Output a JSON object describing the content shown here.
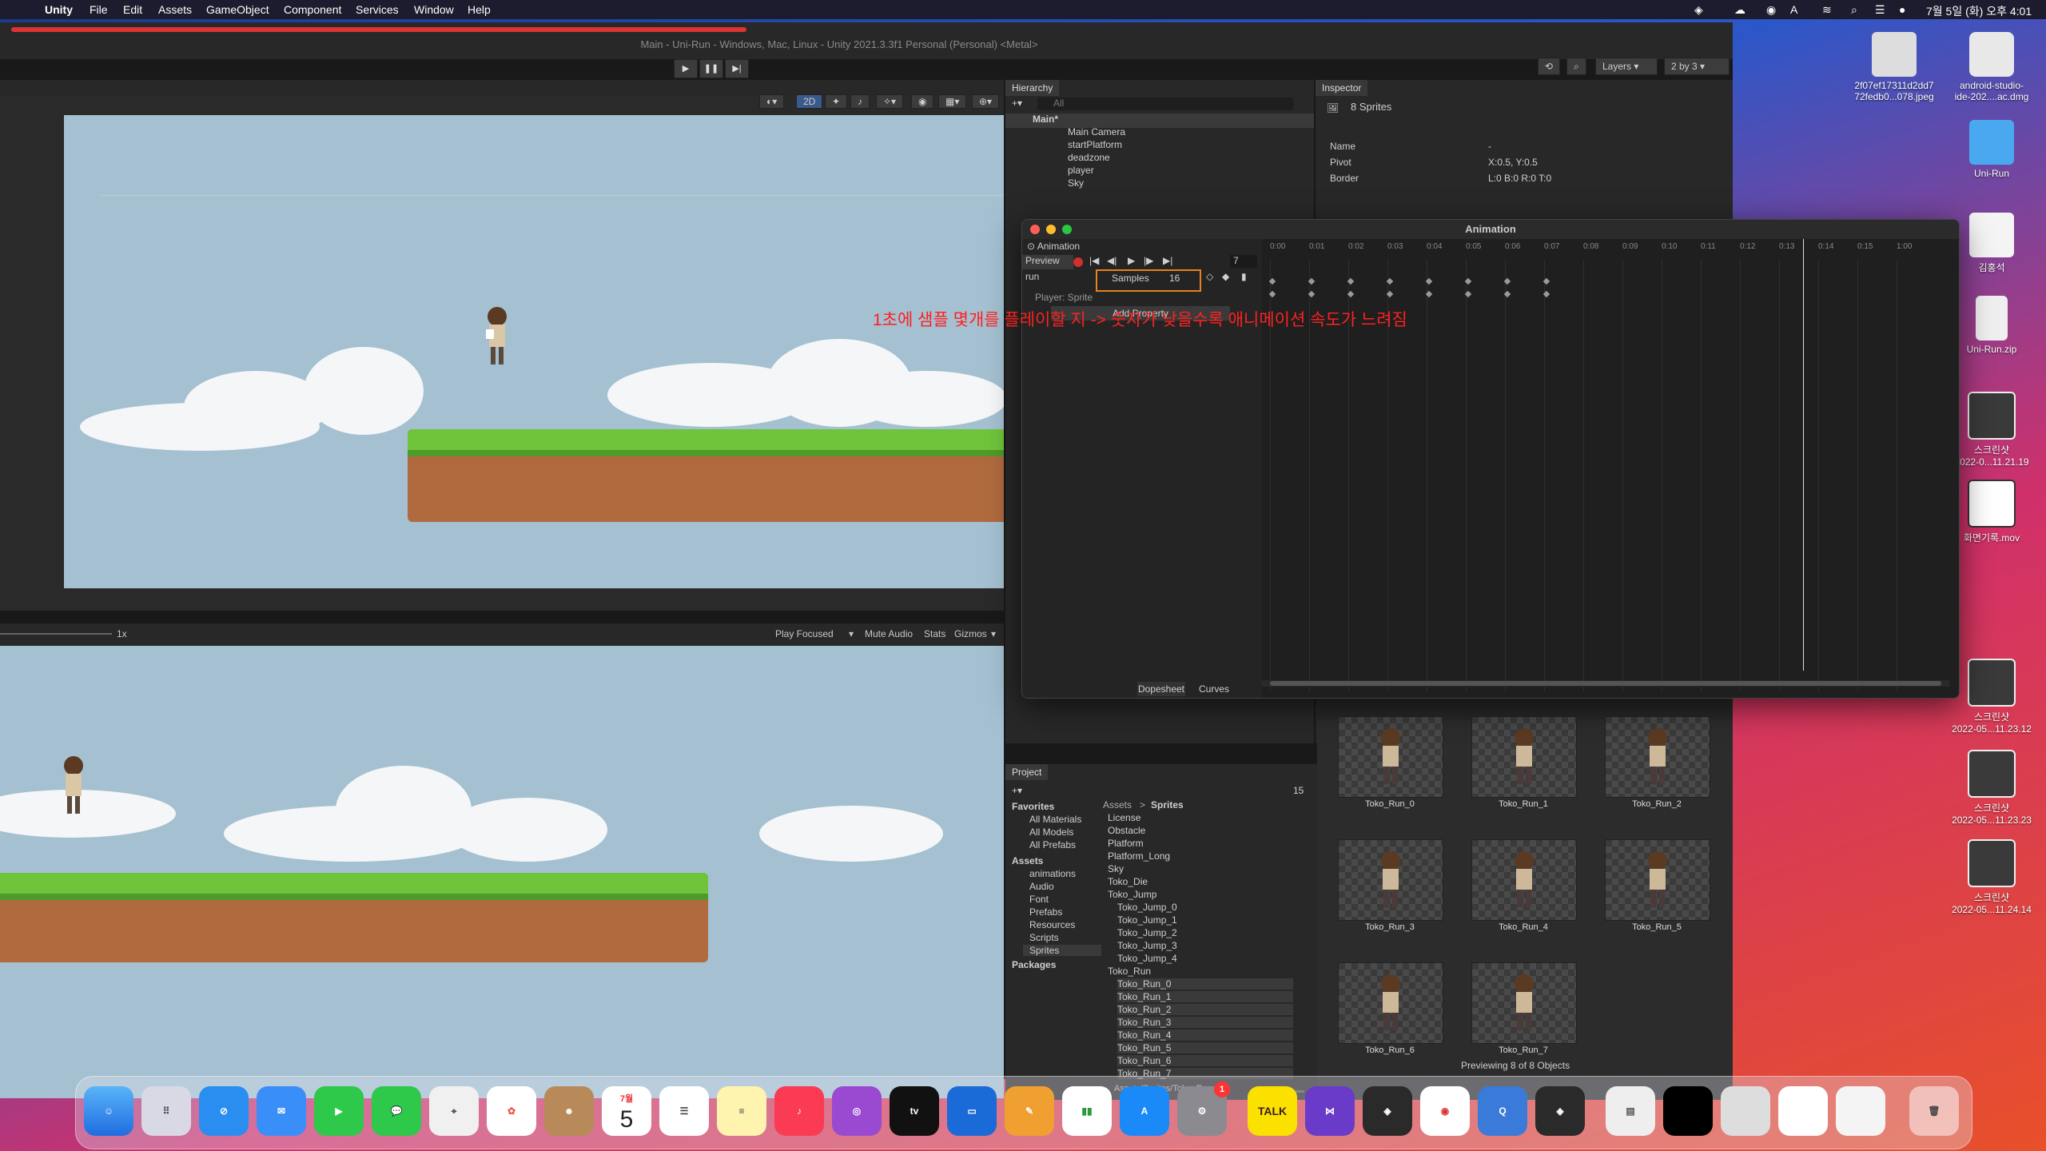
{
  "menubar": {
    "apple": "",
    "app": "Unity",
    "menus": [
      "File",
      "Edit",
      "Assets",
      "GameObject",
      "Component",
      "Services",
      "Window",
      "Help"
    ],
    "clock": "7월 5일 (화) 오후 4:01"
  },
  "window": {
    "title": "Main - Uni-Run - Windows, Mac, Linux - Unity 2021.3.3f1 Personal (Personal) <Metal>",
    "play": "▶",
    "pause": "❚❚",
    "step": "▶|",
    "layers": "Layers",
    "layout": "2 by 3"
  },
  "scene": {
    "mode_2d": "2D"
  },
  "game": {
    "scale": "1x",
    "play_focused": "Play Focused",
    "mute": "Mute Audio",
    "stats": "Stats",
    "gizmos": "Gizmos"
  },
  "hierarchy": {
    "tab": "Hierarchy",
    "search": "All",
    "root": "Main*",
    "items": [
      "Main Camera",
      "startPlatform",
      "deadzone",
      "player",
      "Sky"
    ]
  },
  "inspector": {
    "tab": "Inspector",
    "header": "8 Sprites",
    "rows": [
      {
        "label": "Name",
        "value": "-"
      },
      {
        "label": "Pivot",
        "value": "X:0.5, Y:0.5"
      },
      {
        "label": "Border",
        "value": "L:0 B:0 R:0 T:0"
      }
    ]
  },
  "animation": {
    "window_title": "Animation",
    "tab": "Animation",
    "preview": "Preview",
    "frame": "7",
    "clip": "run",
    "samples_label": "Samples",
    "samples_value": "16",
    "property": "Player: Sprite",
    "add_property": "Add Property",
    "ticks": [
      "0:00",
      "0:01",
      "0:02",
      "0:03",
      "0:04",
      "0:05",
      "0:06",
      "0:07",
      "0:08",
      "0:09",
      "0:10",
      "0:11",
      "0:12",
      "0:13",
      "0:14",
      "0:15",
      "1:00"
    ],
    "dopesheet": "Dopesheet",
    "curves": "Curves",
    "annotation": "1초에 샘플 몇개를 플레이할 지 -> 숫자가 낮을수록 애니메이션 속도가 느려짐"
  },
  "project": {
    "tab": "Project",
    "count": "15",
    "favorites": "Favorites",
    "fav_items": [
      "All Materials",
      "All Models",
      "All Prefabs"
    ],
    "assets": "Assets",
    "asset_folders": [
      "animations",
      "Audio",
      "Font",
      "Prefabs",
      "Resources",
      "Scripts",
      "Sprites"
    ],
    "packages": "Packages",
    "breadcrumb_root": "Assets",
    "breadcrumb_sep": ">",
    "breadcrumb_leaf": "Sprites",
    "sprites_list": [
      "License",
      "Obstacle",
      "Platform",
      "Platform_Long",
      "Sky",
      "Toko_Die",
      "Toko_Jump",
      "Toko_Jump_0",
      "Toko_Jump_1",
      "Toko_Jump_2",
      "Toko_Jump_3",
      "Toko_Jump_4",
      "Toko_Run",
      "Toko_Run_0",
      "Toko_Run_1",
      "Toko_Run_2",
      "Toko_Run_3",
      "Toko_Run_4",
      "Toko_Run_5",
      "Toko_Run_6",
      "Toko_Run_7"
    ],
    "thumbs": [
      "Toko_Run_0",
      "Toko_Run_1",
      "Toko_Run_2",
      "Toko_Run_3",
      "Toko_Run_4",
      "Toko_Run_5",
      "Toko_Run_6",
      "Toko_Run_7"
    ],
    "preview_text": "Previewing 8 of 8 Objects",
    "path": "Assets/Sprites/Toko_Run.png"
  },
  "desktop": {
    "icons": [
      {
        "label": "2f07ef17311d2dd7\n72fedb0...078.jpeg",
        "icon": "image-file-icon"
      },
      {
        "label": "android-studio-\nide-202....ac.dmg",
        "icon": "disk-image-icon"
      },
      {
        "label": "Uni-Run",
        "icon": "folder-icon"
      },
      {
        "label": "김홍석",
        "icon": "document-icon"
      },
      {
        "label": "Uni-Run.zip",
        "icon": "zip-icon"
      },
      {
        "label": "스크린샷\n2022-0...11.21.19",
        "icon": "screenshot-icon"
      },
      {
        "label": "화면기록.mov",
        "icon": "video-icon"
      },
      {
        "label": "스크린샷\n2022-05...11.23.12",
        "icon": "screenshot-icon"
      },
      {
        "label": "스크린샷\n2022-05...11.23.23",
        "icon": "screenshot-icon"
      },
      {
        "label": "스크린샷\n2022-05...11.24.14",
        "icon": "screenshot-icon"
      }
    ]
  },
  "dock": {
    "calendar_month": "7월",
    "calendar_day": "5",
    "appletv": "tv",
    "kakaotalk": "TALK",
    "settings_badge": "1"
  },
  "colors": {
    "unity_dark": "#191919",
    "panel": "#282828",
    "highlight_orange": "#e8821c",
    "annotation_red": "#ff2020",
    "record_red": "#d03030",
    "playhead": "#ffffff"
  }
}
